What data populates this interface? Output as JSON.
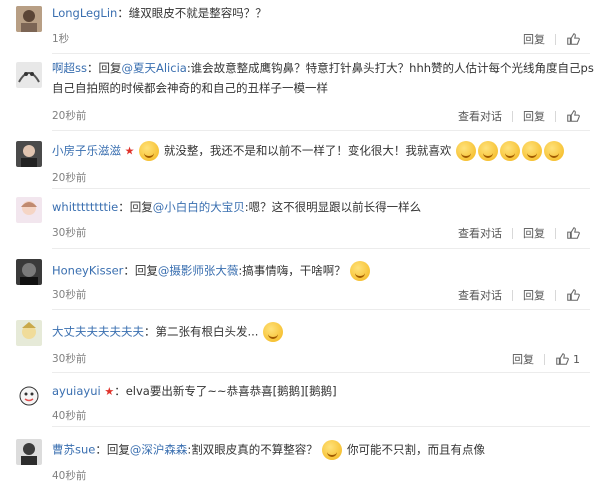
{
  "labels": {
    "reply": "回复",
    "view_convo": "查看对话"
  },
  "comments": [
    {
      "user": "LongLegLin",
      "text": "：缝双眼皮不就是整容吗？？",
      "time": "1秒",
      "convo": false,
      "likes": ""
    },
    {
      "user": "啊超ss",
      "reply_prefix": "：回复",
      "mention": "@夏天Alicia",
      "text": ":谁会故意整成鹰钩鼻？特意打针鼻头打大？hhh赞的人估计每个光线角度自己ps",
      "text2": "自己自拍照的时候都会神奇的和自己的丑样子一模一样",
      "time": "20秒前",
      "convo": true,
      "likes": ""
    },
    {
      "user": "小房子乐滋滋",
      "text": "就没整，我还不是和以前不一样了！变化很大！我就喜欢",
      "time": "20秒前",
      "convo": false,
      "likes": ""
    },
    {
      "user": "whittttttttie",
      "reply_prefix": "：回复",
      "mention": "@小白白的大宝贝",
      "text": ":嗯？这不很明显跟以前长得一样么",
      "time": "30秒前",
      "convo": true,
      "likes": ""
    },
    {
      "user": "HoneyKisser",
      "reply_prefix": "：回复",
      "mention": "@摄影师张大薇",
      "text": ":搞事情嗨，干啥啊？",
      "time": "30秒前",
      "convo": true,
      "likes": ""
    },
    {
      "user": "大丈夫夫夫夫夫夫",
      "text": "：第二张有根白头发...",
      "time": "30秒前",
      "convo": false,
      "likes": "1"
    },
    {
      "user": "ayuiayui",
      "text": "：elva要出新专了~~恭喜恭喜[鹅鹅][鹅鹅]",
      "time": "40秒前",
      "convo": false,
      "likes": ""
    },
    {
      "user": "曹苏sue",
      "reply_prefix": "：回复",
      "mention": "@深沪森森",
      "text": ":割双眼皮真的不算整容？",
      "text_after": "你可能不只割，而且有点像",
      "time": "40秒前",
      "convo": false,
      "likes": ""
    }
  ]
}
